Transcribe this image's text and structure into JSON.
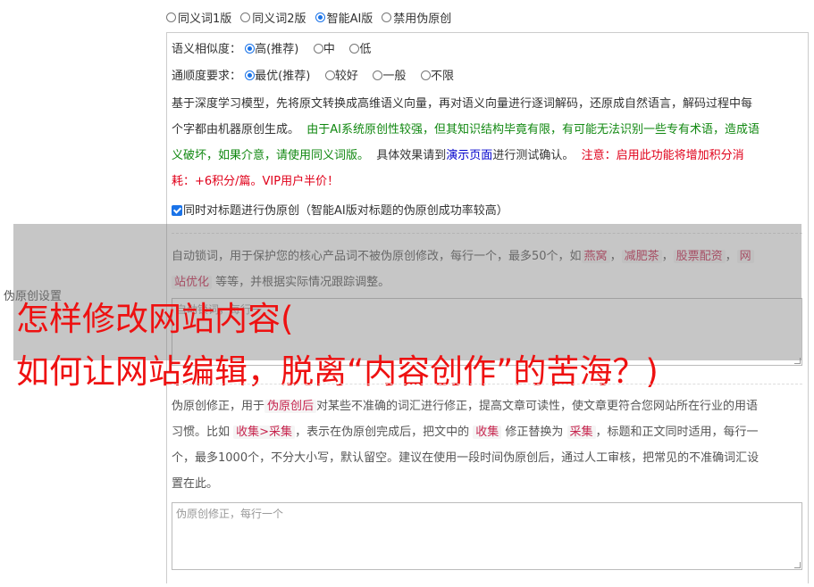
{
  "top_options": [
    {
      "label": "同义词1版",
      "selected": false
    },
    {
      "label": "同义词2版",
      "selected": false
    },
    {
      "label": "智能AI版",
      "selected": true
    },
    {
      "label": "禁用伪原创",
      "selected": false
    }
  ],
  "similarity": {
    "label": "语义相似度：",
    "options": [
      "高(推荐)",
      "中",
      "低"
    ]
  },
  "fluency": {
    "label": "通顺度要求：",
    "options": [
      "最优(推荐)",
      "较好",
      "一般",
      "不限"
    ]
  },
  "desc": {
    "p1": "基于深度学习模型，先将原文转换成高维语义向量，再对语义向量进行逐词解码，还原成自然语言，解码过程中每",
    "p2a": "个字都由机器原创生成。",
    "p2b": "由于AI系统原创性较强，但其知识结构毕竟有限，有可能无法识别一些专有术语，造成语",
    "p3a": "义破坏，如果介意，请使用同义词版。",
    "p3b": "具体效果请到",
    "p3c": "演示页面",
    "p3d": "进行测试确认。",
    "p3e": "注意：启用此功能将增加积分消",
    "p4": "耗：+6积分/篇。VIP用户半价！"
  },
  "title_checkbox": "同时对标题进行伪原创（智能AI版对标题的伪原创成功率较高）",
  "side_label": "伪原创设置",
  "lock": {
    "text_a": "自动锁词，用于保护您的核心产品词不被伪原创修改，每行一个，最多50个，如",
    "tags": [
      "燕窝",
      "减肥茶",
      "股票配资",
      "网"
    ],
    "tag_last": "站优化",
    "text_b": "等等，并根据实际情况跟踪调整。",
    "placeholder": "自动锁词，每行一"
  },
  "correct": {
    "l1a": "伪原创修正，用于",
    "l1tag": "伪原创后",
    "l1b": "对某些不准确的词汇进行修正，提高文章可读性，使文章更符合您网站所在行业的用语",
    "l2a": "习惯。比如",
    "l2tag1": "收集>采集",
    "l2b": "，表示在伪原创完成后，把文中的",
    "l2tag2": "收集",
    "l2c": "修正替换为",
    "l2tag3": "采集",
    "l2d": "，标题和正文同时适用，每行一",
    "l3": "个，最多1000个，不分大小写，默认留空。建议在使用一段时间伪原创后，通过人工审核，把常见的不准确词汇设",
    "l4": "置在此。",
    "placeholder": "伪原创修正，每行一个"
  },
  "headline": {
    "line1": "怎样修改网站内容(",
    "line2": "如何让网站编辑，脱离“内容创作”的苦海？)"
  }
}
